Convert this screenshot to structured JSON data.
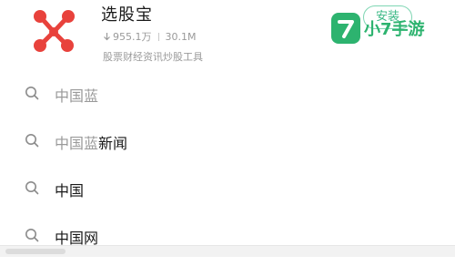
{
  "app": {
    "name": "选股宝",
    "downloads": "955.1万",
    "size": "30.1M",
    "description": "股票财经资讯炒股工具",
    "install_label": "安装",
    "icon": "xuangubao-logo-icon"
  },
  "watermark": {
    "badge": "7",
    "text": "小7手游"
  },
  "suggestions": [
    {
      "match": "中国蓝",
      "rest": ""
    },
    {
      "match": "中国蓝",
      "rest": "新闻"
    },
    {
      "match": "",
      "rest": "中国"
    },
    {
      "match": "",
      "rest": "中国网"
    }
  ],
  "colors": {
    "accent_green": "#2db36f",
    "install_border": "#7fd6b3",
    "logo_red": "#e8423c"
  }
}
